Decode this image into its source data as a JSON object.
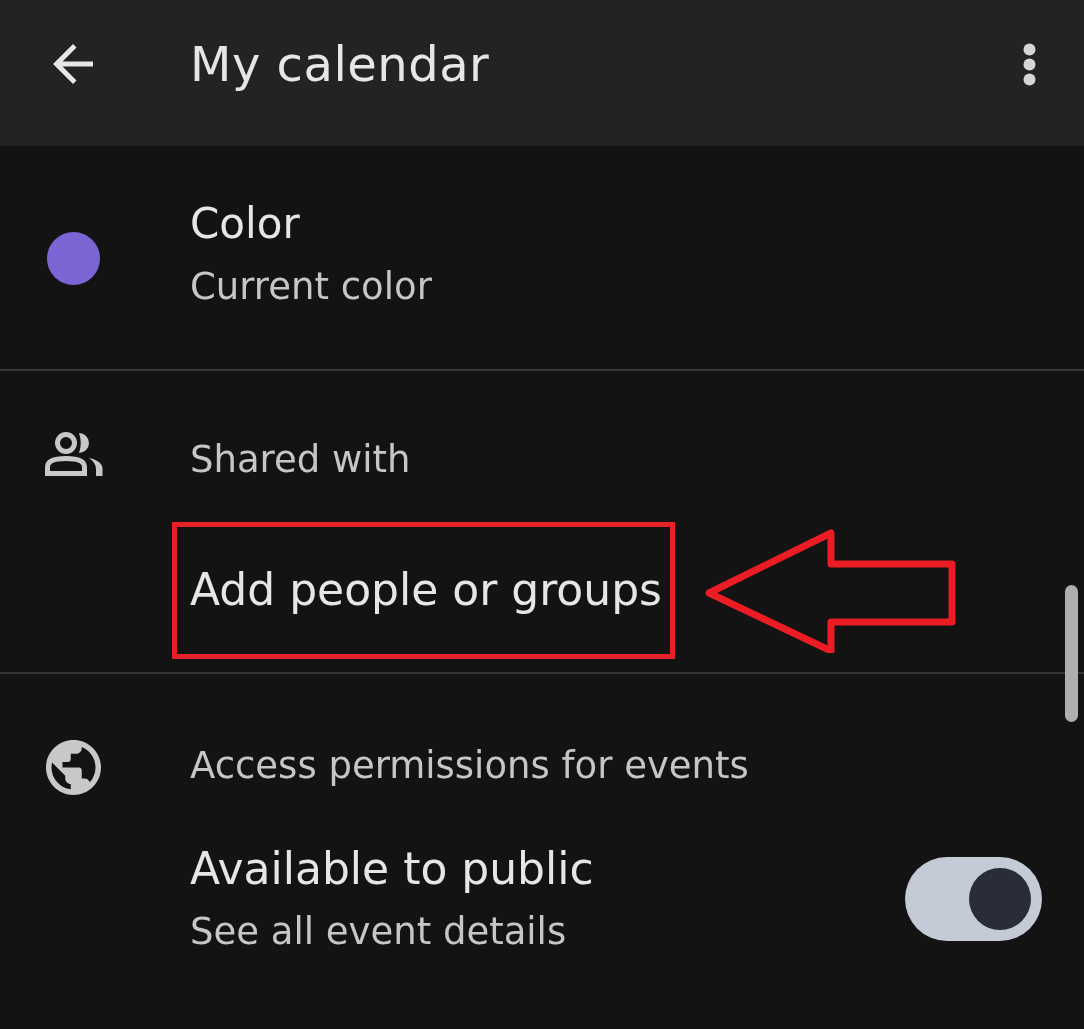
{
  "app_bar": {
    "title": "My calendar"
  },
  "sections": [
    {
      "kind": "color",
      "title": "Color",
      "subtitle": "Current color",
      "color": "#7b65d4"
    },
    {
      "kind": "sharing",
      "heading": "Shared with",
      "action": {
        "label": "Add people or groups",
        "highlighted": true
      }
    },
    {
      "kind": "permissions",
      "heading": "Access permissions for events",
      "setting": {
        "title": "Available to public",
        "subtitle": "See all event details",
        "on": true
      }
    }
  ]
}
